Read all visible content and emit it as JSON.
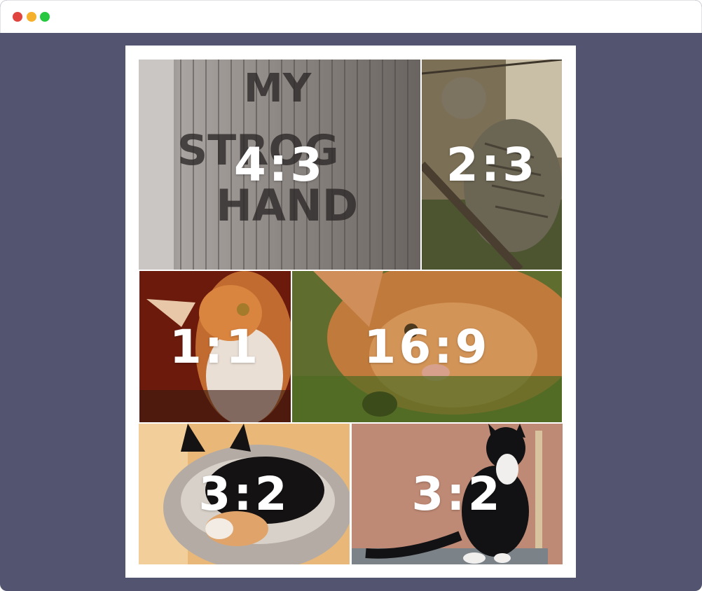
{
  "window": {
    "controls": [
      "close",
      "minimize",
      "maximize"
    ],
    "colors": {
      "close": "#e0443e",
      "minimize": "#f6b12c",
      "maximize": "#27c840",
      "background": "#525470"
    }
  },
  "gallery": {
    "tiles": [
      {
        "label": "4:3",
        "subject": "graffiti-wall-photo"
      },
      {
        "label": "2:3",
        "subject": "tabby-kitten-on-branch-photo"
      },
      {
        "label": "1:1",
        "subject": "orange-white-cat-photo"
      },
      {
        "label": "16:9",
        "subject": "orange-cat-closeup-photo"
      },
      {
        "label": "3:2",
        "subject": "cats-in-basket-photo"
      },
      {
        "label": "3:2",
        "subject": "black-white-cat-photo"
      }
    ]
  },
  "overlay": {
    "wall_text": [
      "MY",
      "STROG",
      "HAND"
    ]
  }
}
